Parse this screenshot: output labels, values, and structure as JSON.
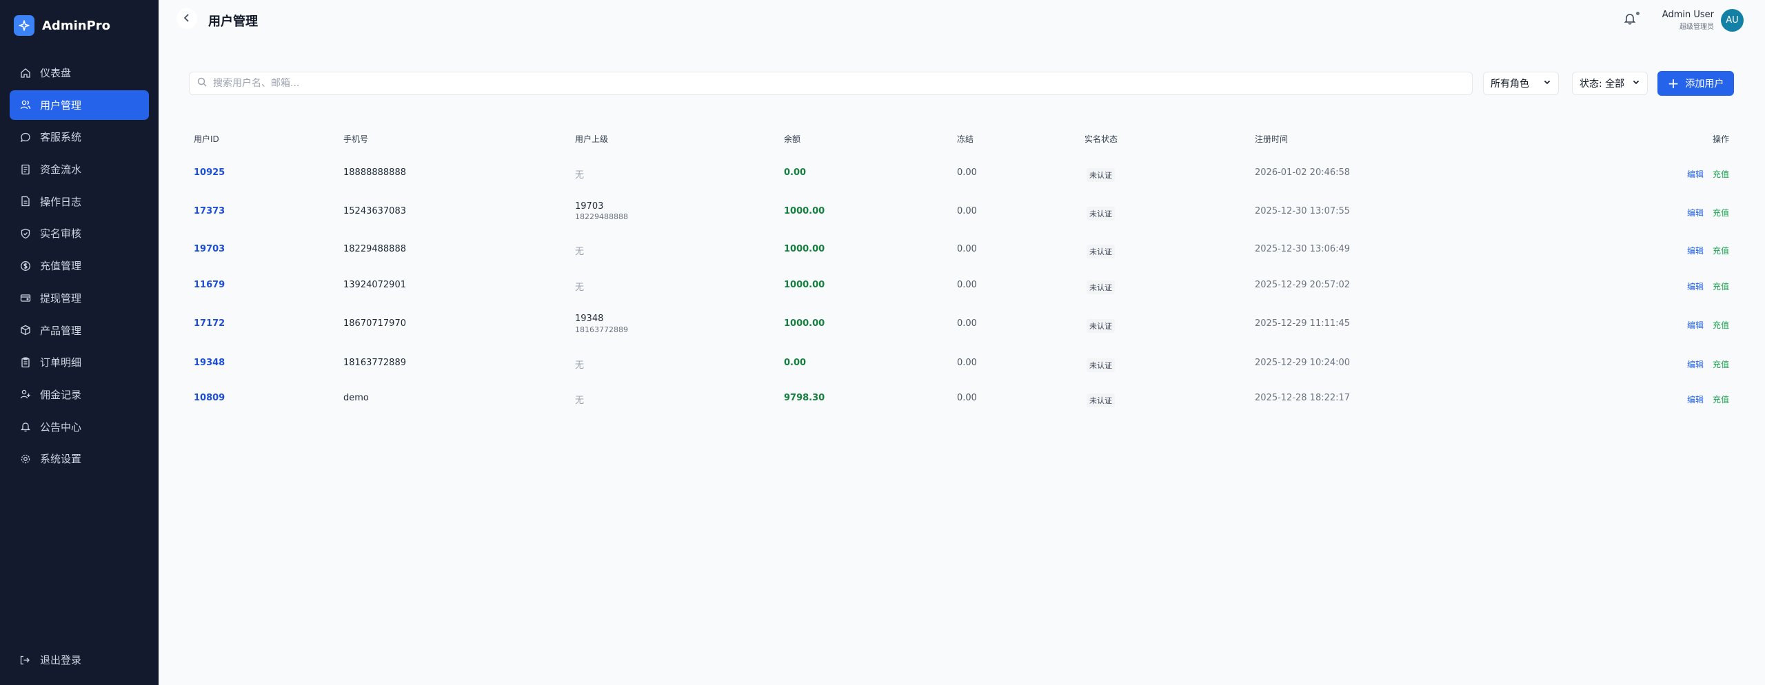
{
  "brand": {
    "name": "AdminPro"
  },
  "nav": [
    {
      "label": "仪表盘",
      "icon": "home-icon"
    },
    {
      "label": "用户管理",
      "icon": "users-icon",
      "active": true
    },
    {
      "label": "客服系统",
      "icon": "chat-icon"
    },
    {
      "label": "资金流水",
      "icon": "ledger-icon"
    },
    {
      "label": "操作日志",
      "icon": "file-icon"
    },
    {
      "label": "实名审核",
      "icon": "shield-icon"
    },
    {
      "label": "充值管理",
      "icon": "coin-icon"
    },
    {
      "label": "提现管理",
      "icon": "wallet-icon"
    },
    {
      "label": "产品管理",
      "icon": "box-icon"
    },
    {
      "label": "订单明细",
      "icon": "clipboard-icon"
    },
    {
      "label": "佣金记录",
      "icon": "commission-icon"
    },
    {
      "label": "公告中心",
      "icon": "bell-icon"
    },
    {
      "label": "系统设置",
      "icon": "gear-icon"
    }
  ],
  "logout": {
    "label": "退出登录"
  },
  "header": {
    "title": "用户管理"
  },
  "user": {
    "name": "Admin User",
    "role": "超级管理员",
    "initials": "AU"
  },
  "toolbar": {
    "search_placeholder": "搜索用户名、邮箱...",
    "role_filter": "所有角色",
    "status_filter": "状态: 全部",
    "add_label": "添加用户"
  },
  "table": {
    "headers": {
      "uid": "用户ID",
      "phone": "手机号",
      "parent": "用户上级",
      "balance": "余额",
      "frozen": "冻结",
      "verify": "实名状态",
      "time": "注册时间",
      "actions": "操作"
    },
    "edit_label": "编辑",
    "charge_label": "充值",
    "rows": [
      {
        "uid": "10925",
        "phone": "18888888888",
        "parent_id": "无",
        "parent_phone": "",
        "has_parent": false,
        "balance": "0.00",
        "frozen": "0.00",
        "verify": "未认证",
        "time": "2026-01-02 20:46:58"
      },
      {
        "uid": "17373",
        "phone": "15243637083",
        "parent_id": "19703",
        "parent_phone": "18229488888",
        "has_parent": true,
        "balance": "1000.00",
        "frozen": "0.00",
        "verify": "未认证",
        "time": "2025-12-30 13:07:55"
      },
      {
        "uid": "19703",
        "phone": "18229488888",
        "parent_id": "无",
        "parent_phone": "",
        "has_parent": false,
        "balance": "1000.00",
        "frozen": "0.00",
        "verify": "未认证",
        "time": "2025-12-30 13:06:49"
      },
      {
        "uid": "11679",
        "phone": "13924072901",
        "parent_id": "无",
        "parent_phone": "",
        "has_parent": false,
        "balance": "1000.00",
        "frozen": "0.00",
        "verify": "未认证",
        "time": "2025-12-29 20:57:02"
      },
      {
        "uid": "17172",
        "phone": "18670717970",
        "parent_id": "19348",
        "parent_phone": "18163772889",
        "has_parent": true,
        "balance": "1000.00",
        "frozen": "0.00",
        "verify": "未认证",
        "time": "2025-12-29 11:11:45"
      },
      {
        "uid": "19348",
        "phone": "18163772889",
        "parent_id": "无",
        "parent_phone": "",
        "has_parent": false,
        "balance": "0.00",
        "frozen": "0.00",
        "verify": "未认证",
        "time": "2025-12-29 10:24:00"
      },
      {
        "uid": "10809",
        "phone": "demo",
        "parent_id": "无",
        "parent_phone": "",
        "has_parent": false,
        "balance": "9798.30",
        "frozen": "0.00",
        "verify": "未认证",
        "time": "2025-12-28 18:22:17"
      }
    ]
  }
}
